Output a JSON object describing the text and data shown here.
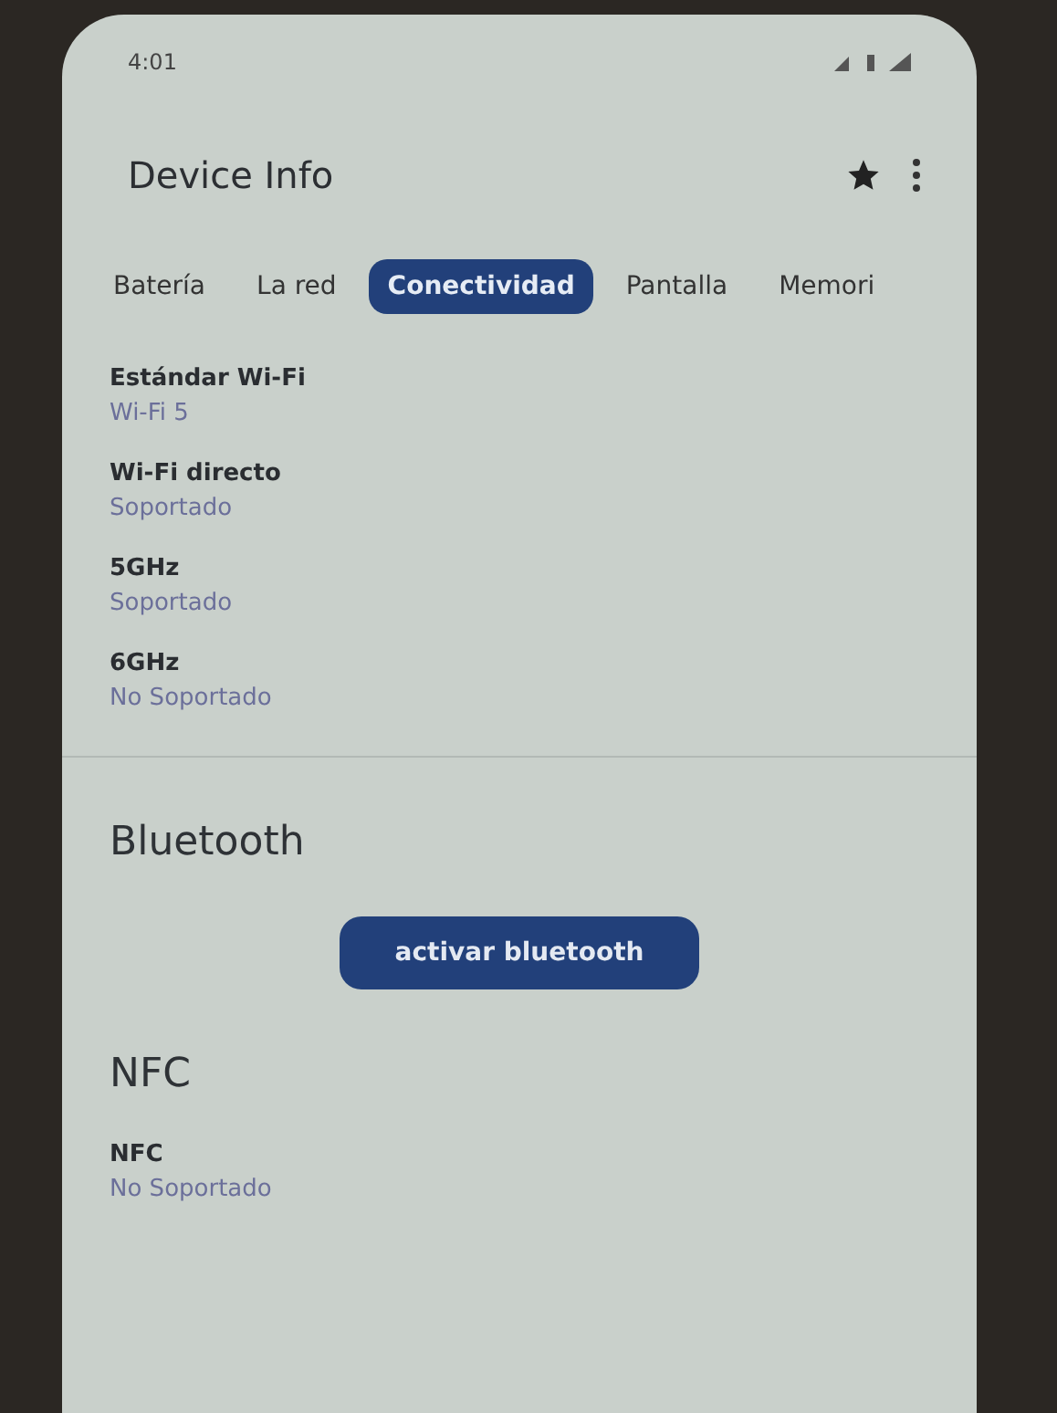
{
  "status_bar": {
    "time": "4:01"
  },
  "app_bar": {
    "title": "Device Info"
  },
  "tabs": [
    {
      "label": "Batería",
      "selected": false
    },
    {
      "label": "La red",
      "selected": false
    },
    {
      "label": "Conectividad",
      "selected": true
    },
    {
      "label": "Pantalla",
      "selected": false
    },
    {
      "label": "Memori",
      "selected": false
    }
  ],
  "wifi_items": [
    {
      "label": "Estándar Wi-Fi",
      "value": "Wi-Fi 5"
    },
    {
      "label": "Wi-Fi directo",
      "value": "Soportado"
    },
    {
      "label": "5GHz",
      "value": "Soportado"
    },
    {
      "label": "6GHz",
      "value": "No Soportado"
    }
  ],
  "bluetooth": {
    "heading": "Bluetooth",
    "button": "activar bluetooth"
  },
  "nfc": {
    "heading": "NFC",
    "items": [
      {
        "label": "NFC",
        "value": "No Soportado"
      }
    ]
  }
}
